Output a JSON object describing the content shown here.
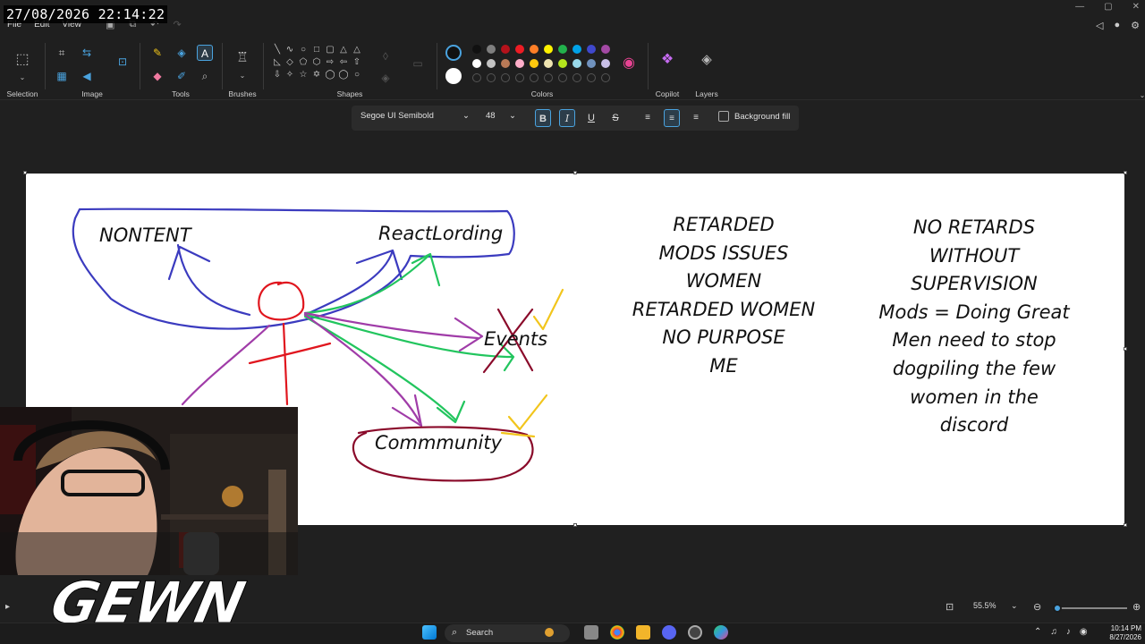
{
  "overlay": {
    "timestamp": "27/08/2026 22:14:22"
  },
  "menu": {
    "file": "File",
    "edit": "Edit",
    "view": "View"
  },
  "ribbon": {
    "selection_label": "Selection",
    "image_label": "Image",
    "tools_label": "Tools",
    "brushes_label": "Brushes",
    "shapes_label": "Shapes",
    "colors_label": "Colors",
    "copilot_label": "Copilot",
    "layers_label": "Layers"
  },
  "palette": {
    "primary": "#111111",
    "secondary": "#ffffff",
    "row1": [
      "#111111",
      "#7f7f7f",
      "#b5121b",
      "#ed1c24",
      "#ff7f27",
      "#fff200",
      "#22b14c",
      "#00a2e8",
      "#3f48cc",
      "#a349a4"
    ],
    "row2": [
      "#ffffff",
      "#c3c3c3",
      "#b97a57",
      "#ffaec9",
      "#ffc90e",
      "#efe4b0",
      "#b5e61d",
      "#99d9ea",
      "#7092be",
      "#c8bfe7"
    ]
  },
  "text_toolbar": {
    "font": "Segoe UI Semibold",
    "size": "48",
    "bold": "B",
    "italic": "I",
    "underline": "U",
    "strike": "S",
    "background_fill": "Background fill"
  },
  "canvas": {
    "labels": {
      "nontent": "NONTENT",
      "reactlording": "ReactLording",
      "events": "Events",
      "community": "Commmunity"
    },
    "left_list": [
      "RETARDED",
      "MODS ISSUES",
      "WOMEN",
      "RETARDED WOMEN",
      "NO PURPOSE",
      "ME"
    ],
    "right_list": [
      "NO RETARDS",
      "WITHOUT",
      "SUPERVISION",
      "Mods = Doing Great",
      "Men need to stop",
      "dogpiling the few",
      "women in the",
      "discord"
    ],
    "stroke_colors": {
      "blue": "#3b3bbf",
      "red": "#e0161e",
      "green": "#22c55e",
      "purple": "#a03ca8",
      "maroon": "#8a0a2a",
      "yellow": "#f2c51c"
    }
  },
  "webcam": {
    "logo": "GEWN"
  },
  "statusbar": {
    "zoom": "55.5%",
    "zoom_fraction": 0.05
  },
  "taskbar": {
    "search": "Search",
    "time": "10:14 PM",
    "date": "8/27/2026"
  }
}
